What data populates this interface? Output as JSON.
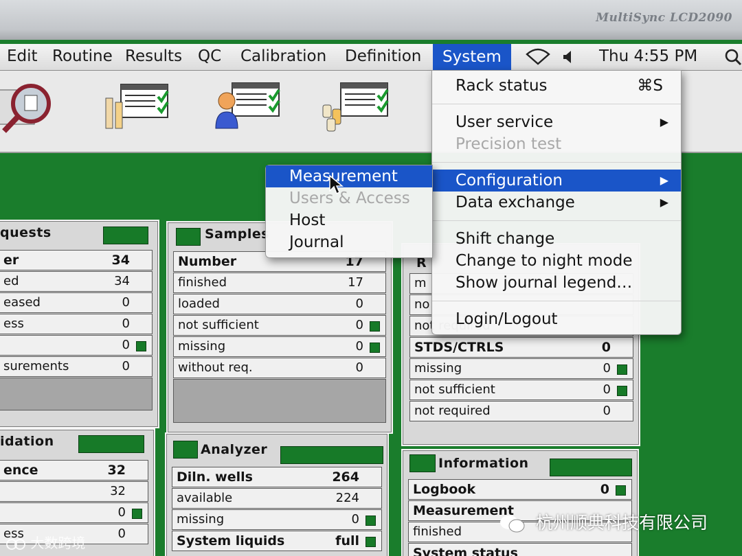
{
  "bezel": {
    "brand": "MultiSync LCD2090"
  },
  "menubar": {
    "items": [
      "Edit",
      "Routine",
      "Results",
      "QC",
      "Calibration",
      "Definition",
      "System"
    ],
    "active": "System",
    "clock": "Thu 4:55 PM"
  },
  "toolbar": {
    "icons": [
      "requests-tool-icon",
      "samples-tool-icon",
      "users-tool-icon",
      "reagents-tool-icon"
    ]
  },
  "system_menu": {
    "items": [
      {
        "label": "Rack status",
        "shortcut": "⌘S"
      },
      {
        "label": "User service",
        "submenu": true
      },
      {
        "label": "Precision test",
        "disabled": true
      },
      {
        "label": "Configuration",
        "submenu": true,
        "highlight": true
      },
      {
        "label": "Data exchange",
        "submenu": true
      },
      {
        "label": "Shift change"
      },
      {
        "label": "Change to night mode"
      },
      {
        "label": "Show journal legend…"
      },
      {
        "label": "Login/Logout"
      }
    ]
  },
  "config_submenu": {
    "items": [
      {
        "label": "Measurement",
        "highlight": true
      },
      {
        "label": "Users & Access",
        "disabled": true
      },
      {
        "label": "Host"
      },
      {
        "label": "Journal"
      }
    ]
  },
  "panels": {
    "requests": {
      "title": "quests",
      "rows": [
        {
          "label": "er",
          "value": "34",
          "bold": true
        },
        {
          "label": "ed",
          "value": "34"
        },
        {
          "label": "eased",
          "value": "0"
        },
        {
          "label": "ess",
          "value": "0"
        },
        {
          "label": "",
          "value": "0",
          "flag": true
        },
        {
          "label": "surements",
          "value": "0"
        }
      ]
    },
    "samples": {
      "title": "Samples",
      "rows": [
        {
          "label": "Number",
          "value": "17",
          "bold": true
        },
        {
          "label": "finished",
          "value": "17"
        },
        {
          "label": "loaded",
          "value": "0"
        },
        {
          "label": "not sufficient",
          "value": "0",
          "flag": true
        },
        {
          "label": "missing",
          "value": "0",
          "flag": true
        },
        {
          "label": "without req.",
          "value": "0"
        }
      ]
    },
    "reagents": {
      "title": "R",
      "rows": [
        {
          "label": "m",
          "value": ""
        },
        {
          "label": "no",
          "value": ""
        },
        {
          "label": "not required",
          "value": ""
        },
        {
          "label": "STDS/CTRLS",
          "value": "0",
          "bold": true
        },
        {
          "label": "missing",
          "value": "0",
          "flag": true
        },
        {
          "label": "not sufficient",
          "value": "0",
          "flag": true
        },
        {
          "label": "not required",
          "value": "0"
        }
      ]
    },
    "validation": {
      "title": "idation",
      "rows": [
        {
          "label": "ence",
          "value": "32",
          "bold": true
        },
        {
          "label": "",
          "value": "32"
        },
        {
          "label": "",
          "value": "0",
          "flag": true
        },
        {
          "label": "ess",
          "value": "0"
        }
      ]
    },
    "analyzer": {
      "title": "Analyzer",
      "rows": [
        {
          "label": "Diln. wells",
          "value": "264",
          "bold": true
        },
        {
          "label": "available",
          "value": "224"
        },
        {
          "label": "missing",
          "value": "0",
          "flag": true
        },
        {
          "label": "System liquids",
          "value": "full",
          "bold": true,
          "flag": true
        }
      ]
    },
    "information": {
      "title": "Information",
      "rows": [
        {
          "label": "Logbook",
          "value": "0",
          "bold": true,
          "flag": true
        },
        {
          "label": "Measurement",
          "value": "",
          "bold": true
        },
        {
          "label": "finished",
          "value": ""
        },
        {
          "label": "System status",
          "value": "",
          "bold": true
        }
      ]
    }
  },
  "watermarks": {
    "left": "大数跨境",
    "right": "杭州顺典科技有限公司"
  }
}
